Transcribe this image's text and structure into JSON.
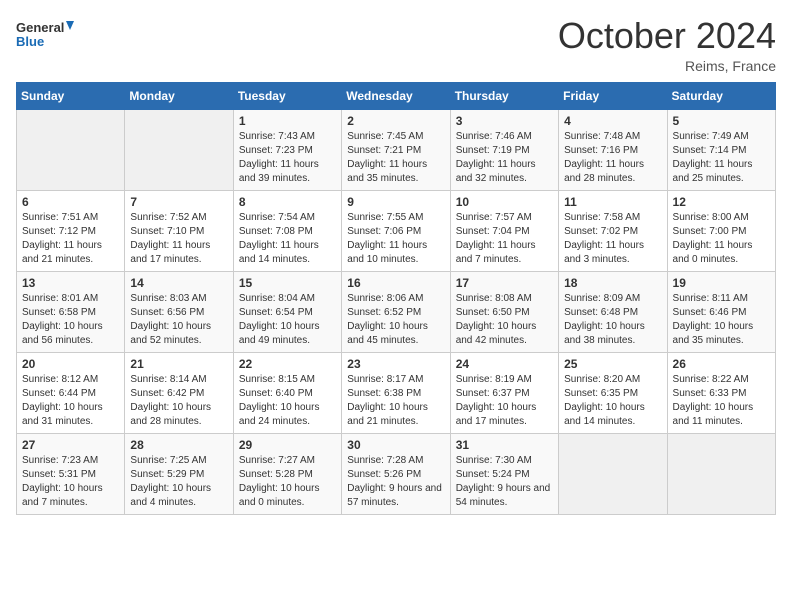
{
  "header": {
    "logo_general": "General",
    "logo_blue": "Blue",
    "month_title": "October 2024",
    "location": "Reims, France"
  },
  "days_of_week": [
    "Sunday",
    "Monday",
    "Tuesday",
    "Wednesday",
    "Thursday",
    "Friday",
    "Saturday"
  ],
  "weeks": [
    [
      {
        "day": "",
        "info": ""
      },
      {
        "day": "",
        "info": ""
      },
      {
        "day": "1",
        "info": "Sunrise: 7:43 AM\nSunset: 7:23 PM\nDaylight: 11 hours and 39 minutes."
      },
      {
        "day": "2",
        "info": "Sunrise: 7:45 AM\nSunset: 7:21 PM\nDaylight: 11 hours and 35 minutes."
      },
      {
        "day": "3",
        "info": "Sunrise: 7:46 AM\nSunset: 7:19 PM\nDaylight: 11 hours and 32 minutes."
      },
      {
        "day": "4",
        "info": "Sunrise: 7:48 AM\nSunset: 7:16 PM\nDaylight: 11 hours and 28 minutes."
      },
      {
        "day": "5",
        "info": "Sunrise: 7:49 AM\nSunset: 7:14 PM\nDaylight: 11 hours and 25 minutes."
      }
    ],
    [
      {
        "day": "6",
        "info": "Sunrise: 7:51 AM\nSunset: 7:12 PM\nDaylight: 11 hours and 21 minutes."
      },
      {
        "day": "7",
        "info": "Sunrise: 7:52 AM\nSunset: 7:10 PM\nDaylight: 11 hours and 17 minutes."
      },
      {
        "day": "8",
        "info": "Sunrise: 7:54 AM\nSunset: 7:08 PM\nDaylight: 11 hours and 14 minutes."
      },
      {
        "day": "9",
        "info": "Sunrise: 7:55 AM\nSunset: 7:06 PM\nDaylight: 11 hours and 10 minutes."
      },
      {
        "day": "10",
        "info": "Sunrise: 7:57 AM\nSunset: 7:04 PM\nDaylight: 11 hours and 7 minutes."
      },
      {
        "day": "11",
        "info": "Sunrise: 7:58 AM\nSunset: 7:02 PM\nDaylight: 11 hours and 3 minutes."
      },
      {
        "day": "12",
        "info": "Sunrise: 8:00 AM\nSunset: 7:00 PM\nDaylight: 11 hours and 0 minutes."
      }
    ],
    [
      {
        "day": "13",
        "info": "Sunrise: 8:01 AM\nSunset: 6:58 PM\nDaylight: 10 hours and 56 minutes."
      },
      {
        "day": "14",
        "info": "Sunrise: 8:03 AM\nSunset: 6:56 PM\nDaylight: 10 hours and 52 minutes."
      },
      {
        "day": "15",
        "info": "Sunrise: 8:04 AM\nSunset: 6:54 PM\nDaylight: 10 hours and 49 minutes."
      },
      {
        "day": "16",
        "info": "Sunrise: 8:06 AM\nSunset: 6:52 PM\nDaylight: 10 hours and 45 minutes."
      },
      {
        "day": "17",
        "info": "Sunrise: 8:08 AM\nSunset: 6:50 PM\nDaylight: 10 hours and 42 minutes."
      },
      {
        "day": "18",
        "info": "Sunrise: 8:09 AM\nSunset: 6:48 PM\nDaylight: 10 hours and 38 minutes."
      },
      {
        "day": "19",
        "info": "Sunrise: 8:11 AM\nSunset: 6:46 PM\nDaylight: 10 hours and 35 minutes."
      }
    ],
    [
      {
        "day": "20",
        "info": "Sunrise: 8:12 AM\nSunset: 6:44 PM\nDaylight: 10 hours and 31 minutes."
      },
      {
        "day": "21",
        "info": "Sunrise: 8:14 AM\nSunset: 6:42 PM\nDaylight: 10 hours and 28 minutes."
      },
      {
        "day": "22",
        "info": "Sunrise: 8:15 AM\nSunset: 6:40 PM\nDaylight: 10 hours and 24 minutes."
      },
      {
        "day": "23",
        "info": "Sunrise: 8:17 AM\nSunset: 6:38 PM\nDaylight: 10 hours and 21 minutes."
      },
      {
        "day": "24",
        "info": "Sunrise: 8:19 AM\nSunset: 6:37 PM\nDaylight: 10 hours and 17 minutes."
      },
      {
        "day": "25",
        "info": "Sunrise: 8:20 AM\nSunset: 6:35 PM\nDaylight: 10 hours and 14 minutes."
      },
      {
        "day": "26",
        "info": "Sunrise: 8:22 AM\nSunset: 6:33 PM\nDaylight: 10 hours and 11 minutes."
      }
    ],
    [
      {
        "day": "27",
        "info": "Sunrise: 7:23 AM\nSunset: 5:31 PM\nDaylight: 10 hours and 7 minutes."
      },
      {
        "day": "28",
        "info": "Sunrise: 7:25 AM\nSunset: 5:29 PM\nDaylight: 10 hours and 4 minutes."
      },
      {
        "day": "29",
        "info": "Sunrise: 7:27 AM\nSunset: 5:28 PM\nDaylight: 10 hours and 0 minutes."
      },
      {
        "day": "30",
        "info": "Sunrise: 7:28 AM\nSunset: 5:26 PM\nDaylight: 9 hours and 57 minutes."
      },
      {
        "day": "31",
        "info": "Sunrise: 7:30 AM\nSunset: 5:24 PM\nDaylight: 9 hours and 54 minutes."
      },
      {
        "day": "",
        "info": ""
      },
      {
        "day": "",
        "info": ""
      }
    ]
  ]
}
